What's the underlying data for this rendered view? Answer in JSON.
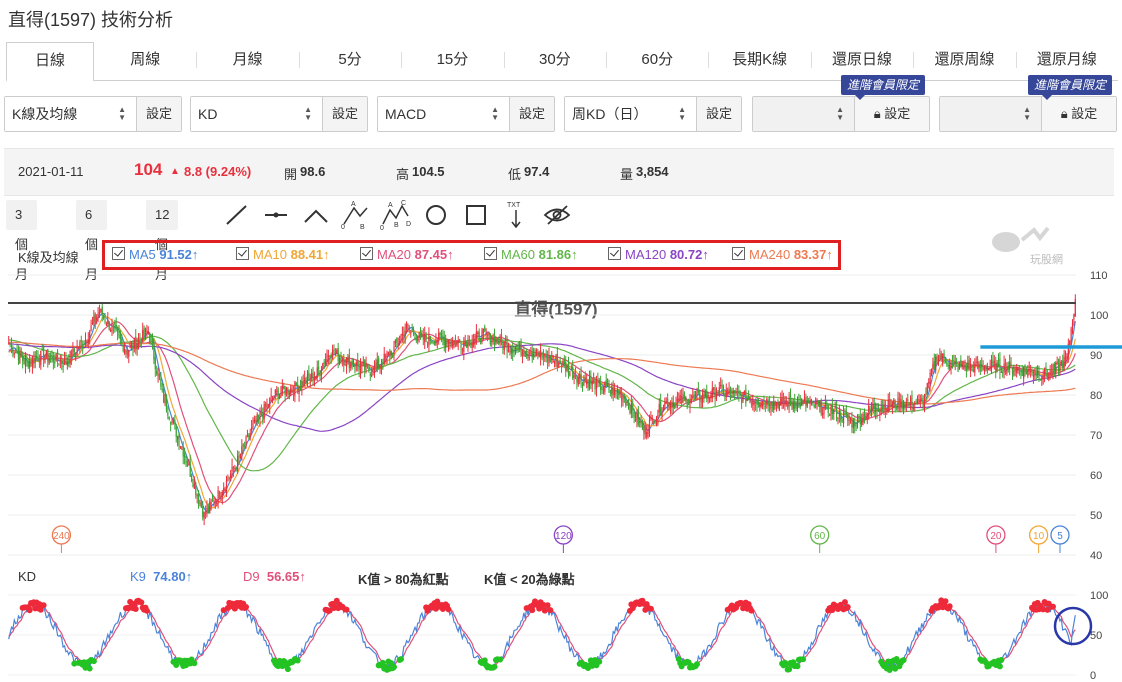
{
  "page_title": "直得(1597) 技術分析",
  "tabs": [
    {
      "label": "日線",
      "active": true
    },
    {
      "label": "周線"
    },
    {
      "label": "月線"
    },
    {
      "label": "5分"
    },
    {
      "label": "15分"
    },
    {
      "label": "30分"
    },
    {
      "label": "60分"
    },
    {
      "label": "長期K線"
    },
    {
      "label": "還原日線"
    },
    {
      "label": "還原周線"
    },
    {
      "label": "還原月線"
    }
  ],
  "selectors": [
    {
      "value": "K線及均線",
      "button": "設定"
    },
    {
      "value": "KD",
      "button": "設定"
    },
    {
      "value": "MACD",
      "button": "設定"
    },
    {
      "value": "周KD（日）",
      "button": "設定"
    },
    {
      "value": "",
      "button": "設定",
      "badge": "進階會員限定",
      "locked": true
    },
    {
      "value": "",
      "button": "設定",
      "badge": "進階會員限定",
      "locked": true
    }
  ],
  "quote": {
    "date": "2021-01-11",
    "price": "104",
    "change": "8.8 (9.24%)",
    "open_label": "開",
    "open": "98.6",
    "high_label": "高",
    "high": "104.5",
    "low_label": "低",
    "low": "97.4",
    "volume_label": "量",
    "volume": "3,854",
    "up_color": "#e8303e"
  },
  "periods": [
    "3 個月",
    "6 個月",
    "12 個月"
  ],
  "draw_tools": [
    "line-tool-icon",
    "horizontal-line-icon",
    "angle-line-icon",
    "abc-pattern-icon",
    "abcd-pattern-icon",
    "circle-tool-icon",
    "rectangle-tool-icon",
    "text-tool-icon",
    "hide-eye-icon"
  ],
  "text_tool_label": "TXT",
  "abc_letters": {
    "a": "A",
    "b": "B",
    "c": "C",
    "d": "D",
    "zero": "0"
  },
  "watermark": "玩股網",
  "ma_legend_label": "K線及均線",
  "ma_legend": [
    {
      "name": "MA5",
      "value": "91.52",
      "arrow": "↑",
      "color": "#4a84d8"
    },
    {
      "name": "MA10",
      "value": "88.41",
      "arrow": "↑",
      "color": "#f0a634"
    },
    {
      "name": "MA20",
      "value": "87.45",
      "arrow": "↑",
      "color": "#e0507a"
    },
    {
      "name": "MA60",
      "value": "81.86",
      "arrow": "↑",
      "color": "#62b64a"
    },
    {
      "name": "MA120",
      "value": "80.72",
      "arrow": "↑",
      "color": "#8a44c4"
    },
    {
      "name": "MA240",
      "value": "83.37",
      "arrow": "↑",
      "color": "#ec7a52"
    }
  ],
  "kd_legend": {
    "label": "KD",
    "k_name": "K9",
    "k_value": "74.80",
    "k_arrow": "↑",
    "k_color": "#4a84d8",
    "d_name": "D9",
    "d_value": "56.65",
    "d_arrow": "↑",
    "d_color": "#e0507a",
    "rule_red": "K值 > 80為紅點",
    "rule_green": "K值 < 20為綠點"
  },
  "chart_data": [
    {
      "type": "candlestick",
      "title": "直得(1597)",
      "ylim": [
        40,
        110
      ],
      "yticks": [
        40,
        50,
        60,
        70,
        80,
        90,
        100,
        110
      ],
      "resistance_line": 103,
      "annotation_line": 92,
      "ma_markers": [
        {
          "label": "240",
          "color": "#ec7a52"
        },
        {
          "label": "120",
          "color": "#8a44c4"
        },
        {
          "label": "60",
          "color": "#62b64a"
        },
        {
          "label": "20",
          "color": "#e0507a"
        },
        {
          "label": "10",
          "color": "#f0a634"
        },
        {
          "label": "5",
          "color": "#4a84d8"
        }
      ],
      "close_anchors": [
        [
          0,
          93
        ],
        [
          12,
          88
        ],
        [
          25,
          90
        ],
        [
          40,
          88
        ],
        [
          55,
          94
        ],
        [
          65,
          101
        ],
        [
          75,
          96
        ],
        [
          85,
          91
        ],
        [
          100,
          96
        ],
        [
          110,
          80
        ],
        [
          125,
          66
        ],
        [
          140,
          50
        ],
        [
          150,
          55
        ],
        [
          162,
          62
        ],
        [
          175,
          72
        ],
        [
          190,
          80
        ],
        [
          205,
          82
        ],
        [
          220,
          85
        ],
        [
          230,
          91
        ],
        [
          245,
          88
        ],
        [
          260,
          86
        ],
        [
          275,
          91
        ],
        [
          285,
          97
        ],
        [
          295,
          94
        ],
        [
          310,
          94
        ],
        [
          325,
          93
        ],
        [
          340,
          95
        ],
        [
          360,
          92
        ],
        [
          380,
          90
        ],
        [
          395,
          88
        ],
        [
          410,
          84
        ],
        [
          425,
          82
        ],
        [
          440,
          80
        ],
        [
          455,
          71
        ],
        [
          470,
          78
        ],
        [
          490,
          79
        ],
        [
          510,
          81
        ],
        [
          530,
          79
        ],
        [
          550,
          78
        ],
        [
          570,
          78
        ],
        [
          590,
          76
        ],
        [
          605,
          73
        ],
        [
          620,
          77
        ],
        [
          640,
          78
        ],
        [
          655,
          78
        ],
        [
          665,
          90
        ],
        [
          680,
          87
        ],
        [
          700,
          87
        ],
        [
          715,
          87
        ],
        [
          730,
          86
        ],
        [
          745,
          85
        ],
        [
          758,
          89
        ],
        [
          764,
          104
        ]
      ]
    },
    {
      "type": "line",
      "ylim": [
        0,
        100
      ],
      "yticks": [
        0,
        50,
        100
      ],
      "series": [
        {
          "name": "K9",
          "final": 74.8
        },
        {
          "name": "D9",
          "final": 56.65
        }
      ],
      "overbought": 80,
      "oversold": 20
    }
  ]
}
